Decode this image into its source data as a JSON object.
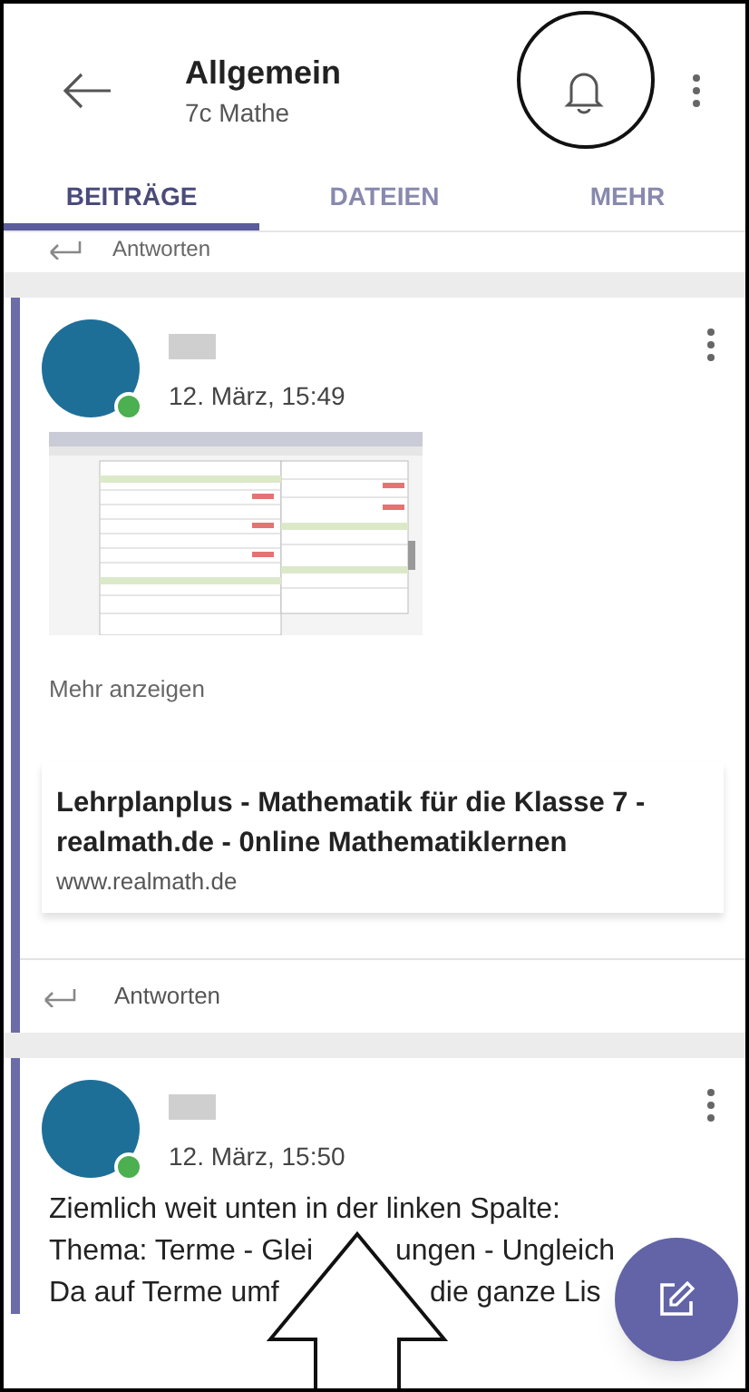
{
  "header": {
    "title": "Allgemein",
    "subtitle": "7c Mathe"
  },
  "tabs": [
    {
      "label": "BEITRÄGE",
      "selected": true
    },
    {
      "label": "DATEIEN",
      "selected": false
    },
    {
      "label": "MEHR",
      "selected": false
    }
  ],
  "previous_reply": "Antworten",
  "posts": [
    {
      "kind": "link",
      "date": "12. März, 15:49",
      "online": true,
      "show_more": "Mehr anzeigen",
      "link": {
        "title": "Lehrplanplus - Mathematik für die Klasse 7 - realmath.de - 0nline Mathematiklernen",
        "url": "www.realmath.de"
      },
      "reply": "Antworten"
    },
    {
      "kind": "text",
      "date": "12. März, 15:50",
      "online": true,
      "lines": [
        [
          "Ziemlich weit unten in der linken Spalte:"
        ],
        [
          "Thema: Terme - Glei",
          "ungen - Ungleich"
        ],
        [
          "Da auf Terme umf",
          "die ganze Lis"
        ]
      ]
    }
  ]
}
